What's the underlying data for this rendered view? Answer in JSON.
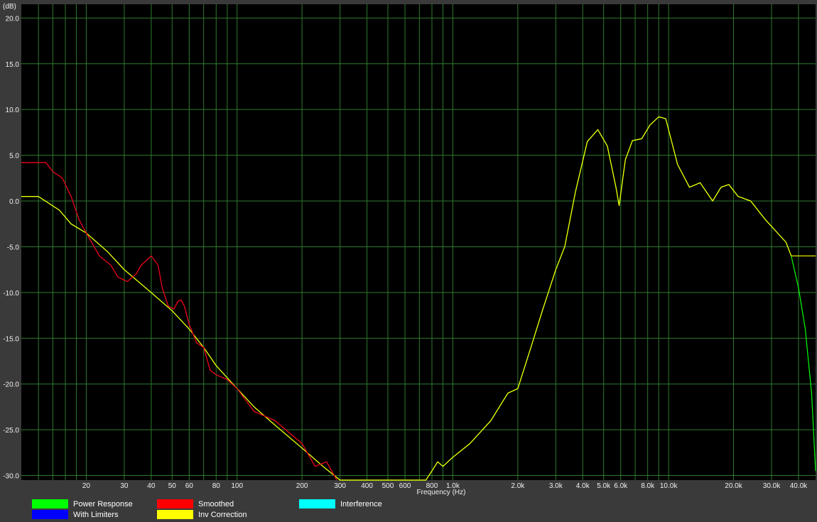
{
  "chart_data": {
    "type": "line",
    "y_unit_label": "(dB)",
    "xlabel": "Frequency (Hz)",
    "x_scale": "log",
    "xlim": [
      10,
      48000
    ],
    "ylim": [
      -30.5,
      21.5
    ],
    "grid": true,
    "legend_position": "bottom",
    "colors": {
      "background": "#000000",
      "frame": "#3a3a3a",
      "grid": "#2f7a2f",
      "text": "#f0f0f0"
    },
    "y_ticks": [
      {
        "value": 20,
        "label": "20.0"
      },
      {
        "value": 15,
        "label": "15.0"
      },
      {
        "value": 10,
        "label": "10.0"
      },
      {
        "value": 5,
        "label": "5.0"
      },
      {
        "value": 0,
        "label": "0.0"
      },
      {
        "value": -5,
        "label": "-5.0"
      },
      {
        "value": -10,
        "label": "-10.0"
      },
      {
        "value": -15,
        "label": "-15.0"
      },
      {
        "value": -20,
        "label": "-20.0"
      },
      {
        "value": -25,
        "label": "-25.0"
      },
      {
        "value": -30,
        "label": "-30.0"
      }
    ],
    "x_ticks": [
      {
        "value": 20,
        "label": "20"
      },
      {
        "value": 30,
        "label": "30"
      },
      {
        "value": 40,
        "label": "40"
      },
      {
        "value": 50,
        "label": "50"
      },
      {
        "value": 60,
        "label": "60"
      },
      {
        "value": 80,
        "label": "80"
      },
      {
        "value": 100,
        "label": "100"
      },
      {
        "value": 200,
        "label": "200"
      },
      {
        "value": 300,
        "label": "300"
      },
      {
        "value": 400,
        "label": "400"
      },
      {
        "value": 500,
        "label": "500"
      },
      {
        "value": 600,
        "label": "600"
      },
      {
        "value": 800,
        "label": "800"
      },
      {
        "value": 1000,
        "label": "1.0k"
      },
      {
        "value": 2000,
        "label": "2.0k"
      },
      {
        "value": 3000,
        "label": "3.0k"
      },
      {
        "value": 4000,
        "label": "4.0k"
      },
      {
        "value": 5000,
        "label": "5.0k"
      },
      {
        "value": 6000,
        "label": "6.0k"
      },
      {
        "value": 8000,
        "label": "8.0k"
      },
      {
        "value": 10000,
        "label": "10.0k"
      },
      {
        "value": 20000,
        "label": "20.0k"
      },
      {
        "value": 30000,
        "label": "30.0k"
      },
      {
        "value": 40000,
        "label": "40.0k"
      }
    ],
    "minor_grid_x": [
      12,
      14,
      16,
      18,
      70,
      90,
      700,
      900,
      7000,
      9000,
      50000
    ],
    "legend": [
      {
        "name": "Power Response",
        "color": "#00ff00"
      },
      {
        "name": "With Limiters",
        "color": "#0000ff"
      },
      {
        "name": "Smoothed",
        "color": "#ff0000"
      },
      {
        "name": "Inv Correction",
        "color": "#ffff00"
      },
      {
        "name": "Interference",
        "color": "#00ffff"
      }
    ],
    "series": [
      {
        "name": "Power Response",
        "color": "#00ff00",
        "points": [
          [
            10,
            0.5
          ],
          [
            12,
            0.5
          ],
          [
            15,
            -1.0
          ],
          [
            17,
            -2.5
          ],
          [
            20,
            -3.5
          ],
          [
            25,
            -5.5
          ],
          [
            30,
            -7.5
          ],
          [
            40,
            -10.0
          ],
          [
            50,
            -12.0
          ],
          [
            60,
            -14.0
          ],
          [
            70,
            -16.0
          ],
          [
            80,
            -18.0
          ],
          [
            100,
            -20.5
          ],
          [
            120,
            -22.5
          ],
          [
            150,
            -24.5
          ],
          [
            200,
            -27.0
          ],
          [
            250,
            -29.0
          ],
          [
            300,
            -30.8
          ],
          [
            400,
            -30.8
          ],
          [
            500,
            -30.8
          ],
          [
            600,
            -30.8
          ],
          [
            750,
            -30.8
          ],
          [
            800,
            -29.5
          ],
          [
            850,
            -28.5
          ],
          [
            900,
            -29.0
          ],
          [
            1000,
            -28.0
          ],
          [
            1200,
            -26.5
          ],
          [
            1500,
            -24.0
          ],
          [
            1800,
            -21.0
          ],
          [
            2000,
            -20.5
          ],
          [
            2300,
            -16.0
          ],
          [
            2600,
            -12.0
          ],
          [
            3000,
            -7.5
          ],
          [
            3300,
            -5.0
          ],
          [
            3700,
            1.0
          ],
          [
            4200,
            6.5
          ],
          [
            4700,
            7.8
          ],
          [
            5200,
            6.0
          ],
          [
            5700,
            1.5
          ],
          [
            5900,
            -0.5
          ],
          [
            6300,
            4.5
          ],
          [
            6800,
            6.6
          ],
          [
            7500,
            6.8
          ],
          [
            8200,
            8.3
          ],
          [
            9000,
            9.2
          ],
          [
            9700,
            9.0
          ],
          [
            11000,
            4.0
          ],
          [
            12500,
            1.5
          ],
          [
            14000,
            2.0
          ],
          [
            16000,
            0.0
          ],
          [
            17500,
            1.5
          ],
          [
            19000,
            1.8
          ],
          [
            21000,
            0.5
          ],
          [
            24000,
            0.0
          ],
          [
            28000,
            -2.0
          ],
          [
            32000,
            -3.5
          ],
          [
            35000,
            -4.5
          ],
          [
            37000,
            -6.0
          ],
          [
            40000,
            -9.5
          ],
          [
            43000,
            -14.0
          ],
          [
            46000,
            -21.0
          ],
          [
            48000,
            -29.5
          ]
        ]
      },
      {
        "name": "Inv Correction",
        "color": "#ffff00",
        "points": [
          [
            10,
            0.5
          ],
          [
            12,
            0.5
          ],
          [
            15,
            -1.0
          ],
          [
            17,
            -2.5
          ],
          [
            20,
            -3.5
          ],
          [
            25,
            -5.5
          ],
          [
            30,
            -7.5
          ],
          [
            40,
            -10.0
          ],
          [
            50,
            -12.0
          ],
          [
            60,
            -14.0
          ],
          [
            70,
            -16.0
          ],
          [
            80,
            -18.0
          ],
          [
            100,
            -20.5
          ],
          [
            120,
            -22.5
          ],
          [
            150,
            -24.5
          ],
          [
            200,
            -27.0
          ],
          [
            250,
            -29.0
          ],
          [
            300,
            -30.8
          ],
          [
            400,
            -30.8
          ],
          [
            500,
            -30.8
          ],
          [
            600,
            -30.8
          ],
          [
            750,
            -30.8
          ],
          [
            800,
            -29.5
          ],
          [
            850,
            -28.5
          ],
          [
            900,
            -29.0
          ],
          [
            1000,
            -28.0
          ],
          [
            1200,
            -26.5
          ],
          [
            1500,
            -24.0
          ],
          [
            1800,
            -21.0
          ],
          [
            2000,
            -20.5
          ],
          [
            2300,
            -16.0
          ],
          [
            2600,
            -12.0
          ],
          [
            3000,
            -7.5
          ],
          [
            3300,
            -5.0
          ],
          [
            3700,
            1.0
          ],
          [
            4200,
            6.5
          ],
          [
            4700,
            7.8
          ],
          [
            5200,
            6.0
          ],
          [
            5700,
            1.5
          ],
          [
            5900,
            -0.5
          ],
          [
            6300,
            4.5
          ],
          [
            6800,
            6.6
          ],
          [
            7500,
            6.8
          ],
          [
            8200,
            8.3
          ],
          [
            9000,
            9.2
          ],
          [
            9700,
            9.0
          ],
          [
            11000,
            4.0
          ],
          [
            12500,
            1.5
          ],
          [
            14000,
            2.0
          ],
          [
            16000,
            0.0
          ],
          [
            17500,
            1.5
          ],
          [
            19000,
            1.8
          ],
          [
            21000,
            0.5
          ],
          [
            24000,
            0.0
          ],
          [
            28000,
            -2.0
          ],
          [
            32000,
            -3.5
          ],
          [
            35000,
            -4.5
          ],
          [
            37000,
            -6.0
          ],
          [
            40000,
            -6.0
          ],
          [
            48000,
            -6.0
          ]
        ]
      },
      {
        "name": "With Limiters",
        "color": "#0000ff",
        "points": [
          [
            10,
            4.2
          ],
          [
            13,
            4.2
          ],
          [
            14,
            3.2
          ],
          [
            15.5,
            2.5
          ],
          [
            17,
            0.5
          ],
          [
            18.5,
            -2.0
          ],
          [
            20,
            -3.5
          ],
          [
            23,
            -6.0
          ],
          [
            26,
            -7.0
          ],
          [
            28,
            -8.3
          ],
          [
            31,
            -8.8
          ],
          [
            34,
            -8.0
          ],
          [
            36,
            -7.0
          ],
          [
            40,
            -6.0
          ],
          [
            43,
            -7.0
          ],
          [
            45,
            -9.5
          ],
          [
            48,
            -11.5
          ],
          [
            51,
            -11.8
          ],
          [
            53,
            -11.0
          ],
          [
            55,
            -10.8
          ],
          [
            57,
            -11.5
          ],
          [
            60,
            -13.5
          ],
          [
            65,
            -15.5
          ],
          [
            70,
            -16.0
          ],
          [
            75,
            -18.5
          ],
          [
            80,
            -19.0
          ],
          [
            90,
            -19.5
          ],
          [
            100,
            -20.5
          ],
          [
            120,
            -23.0
          ],
          [
            150,
            -24.0
          ],
          [
            200,
            -26.5
          ],
          [
            230,
            -29.0
          ],
          [
            260,
            -28.5
          ],
          [
            290,
            -30.8
          ]
        ]
      },
      {
        "name": "Smoothed",
        "color": "#ff0000",
        "points": [
          [
            10,
            4.2
          ],
          [
            13,
            4.2
          ],
          [
            14,
            3.2
          ],
          [
            15.5,
            2.5
          ],
          [
            17,
            0.5
          ],
          [
            18.5,
            -2.0
          ],
          [
            20,
            -3.5
          ],
          [
            23,
            -6.0
          ],
          [
            26,
            -7.0
          ],
          [
            28,
            -8.3
          ],
          [
            31,
            -8.8
          ],
          [
            34,
            -8.0
          ],
          [
            36,
            -7.0
          ],
          [
            40,
            -6.0
          ],
          [
            43,
            -7.0
          ],
          [
            45,
            -9.5
          ],
          [
            48,
            -11.5
          ],
          [
            51,
            -11.8
          ],
          [
            53,
            -11.0
          ],
          [
            55,
            -10.8
          ],
          [
            57,
            -11.5
          ],
          [
            60,
            -13.5
          ],
          [
            65,
            -15.5
          ],
          [
            70,
            -16.0
          ],
          [
            75,
            -18.5
          ],
          [
            80,
            -19.0
          ],
          [
            90,
            -19.5
          ],
          [
            100,
            -20.5
          ],
          [
            120,
            -23.0
          ],
          [
            150,
            -24.0
          ],
          [
            200,
            -26.5
          ],
          [
            230,
            -29.0
          ],
          [
            260,
            -28.5
          ],
          [
            290,
            -30.8
          ]
        ]
      }
    ]
  }
}
